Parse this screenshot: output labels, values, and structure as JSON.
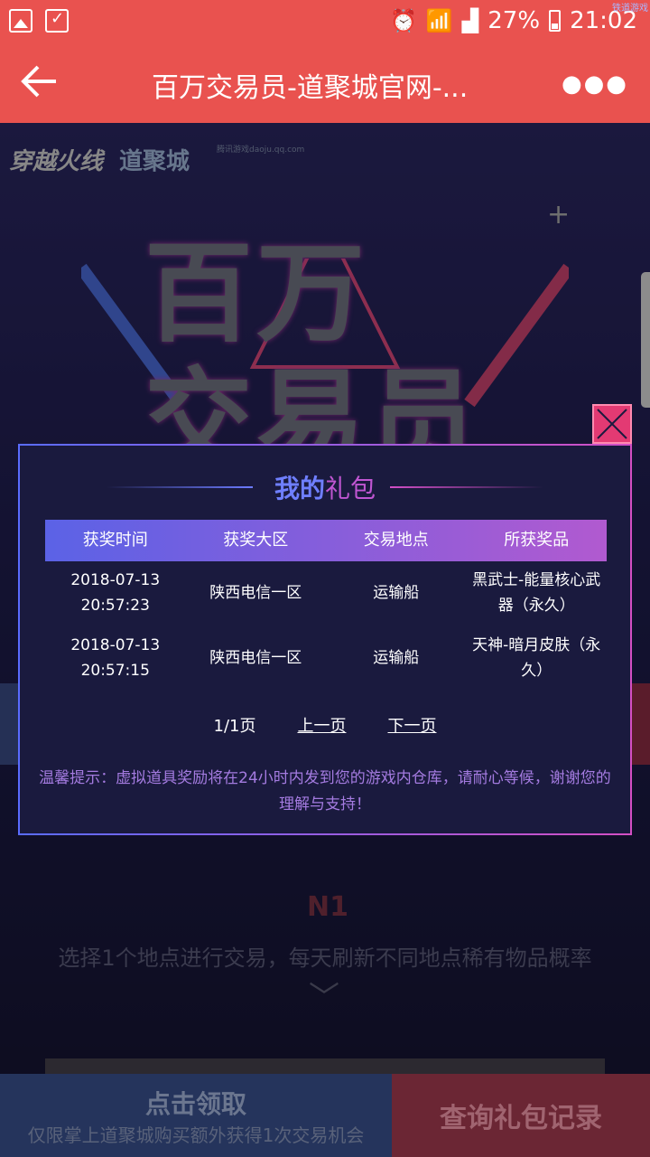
{
  "status_bar": {
    "watermark": "铁道游戏",
    "battery": "27%",
    "time": "21:02"
  },
  "app_bar": {
    "title": "百万交易员-道聚城官网-..."
  },
  "background": {
    "brand_cf": "穿越火线",
    "brand_dj": "道聚城",
    "brand_dj_sub": "腾讯游戏daoju.qq.com",
    "hero_line1": "百万",
    "hero_line2": "交易员",
    "n1_mark": "N1",
    "description": "选择1个地点进行交易，每天刷新不同地点稀有物品概率",
    "claim_button": "点击领取",
    "claim_sub": "仅限掌上道聚城购买额外获得1次交易机会",
    "records_button": "查询礼包记录"
  },
  "modal": {
    "title_part1": "我的",
    "title_part2": "礼包",
    "columns": [
      "获奖时间",
      "获奖大区",
      "交易地点",
      "所获奖品"
    ],
    "rows": [
      [
        "2018-07-13 20:57:23",
        "陕西电信一区",
        "运输船",
        "黑武士-能量核心武器（永久）"
      ],
      [
        "2018-07-13 20:57:15",
        "陕西电信一区",
        "运输船",
        "天神-暗月皮肤（永久）"
      ]
    ],
    "pager": {
      "page_info": "1/1页",
      "prev": "上一页",
      "next": "下一页"
    },
    "tip": "温馨提示：虚拟道具奖励将在24小时内发到您的游戏内仓库，请耐心等候，谢谢您的理解与支持！"
  },
  "colors": {
    "appbar": "#e9524f",
    "modal_bg": "#1a1a3e",
    "accent_blue": "#5b62e6",
    "accent_purple": "#b15ad0",
    "close_btn": "#e33a73"
  }
}
